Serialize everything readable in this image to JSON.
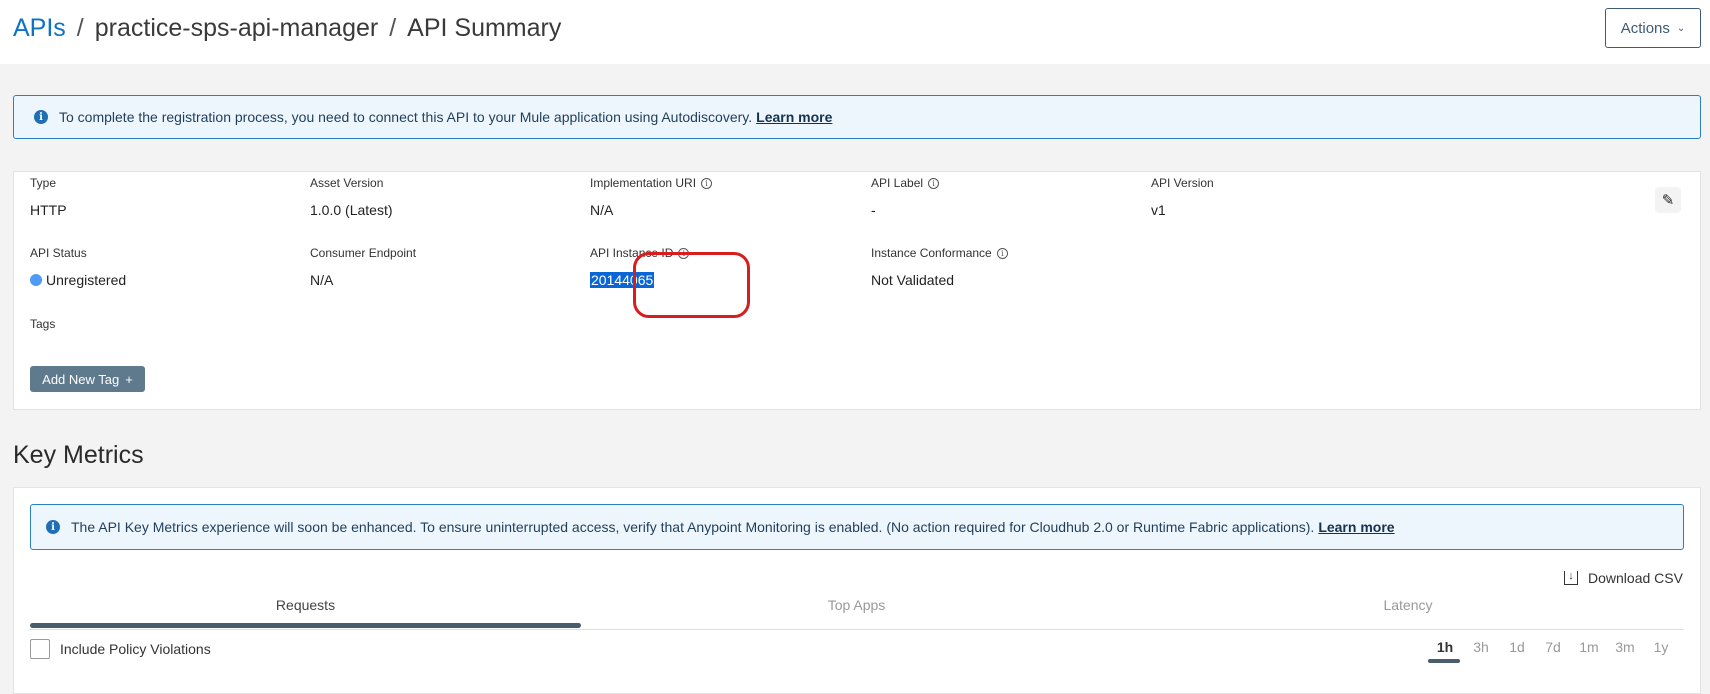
{
  "breadcrumb": {
    "root": "APIs",
    "separator": "/",
    "app": "practice-sps-api-manager",
    "page": "API Summary"
  },
  "actions_button": {
    "label": "Actions",
    "icon": "chevron-down-icon"
  },
  "registration_banner": {
    "text": "To complete the registration process, you need to connect this API to your Mule application using Autodiscovery.",
    "link": "Learn more"
  },
  "summary": {
    "type": {
      "label": "Type",
      "value": "HTTP"
    },
    "asset_version": {
      "label": "Asset Version",
      "value": "1.0.0 (Latest)"
    },
    "implementation_uri": {
      "label": "Implementation URI",
      "value": "N/A"
    },
    "api_label": {
      "label": "API Label",
      "value": "-"
    },
    "api_version": {
      "label": "API Version",
      "value": "v1"
    },
    "api_status": {
      "label": "API Status",
      "value": "Unregistered",
      "color": "#4e9af7"
    },
    "consumer_endpoint": {
      "label": "Consumer Endpoint",
      "value": "N/A"
    },
    "api_instance_id": {
      "label": "API Instance ID",
      "value": "20144065"
    },
    "instance_conformance": {
      "label": "Instance Conformance",
      "value": "Not Validated"
    },
    "tags": {
      "label": "Tags",
      "button": "Add New Tag"
    }
  },
  "key_metrics": {
    "title": "Key Metrics",
    "banner": {
      "text": "The API Key Metrics experience will soon be enhanced. To ensure uninterrupted access, verify that Anypoint Monitoring is enabled. (No action required for Cloudhub 2.0 or Runtime Fabric applications).",
      "link": "Learn more"
    },
    "download_csv": "Download CSV",
    "tabs": [
      "Requests",
      "Top Apps",
      "Latency"
    ],
    "active_tab": "Requests",
    "include_policy_violations": "Include Policy Violations",
    "ranges": [
      "1h",
      "3h",
      "1d",
      "7d",
      "1m",
      "3m",
      "1y"
    ],
    "active_range": "1h"
  },
  "colors": {
    "accent": "#0b74c9",
    "highlight": "#d71d1d",
    "banner_border": "#2a7fc4"
  }
}
